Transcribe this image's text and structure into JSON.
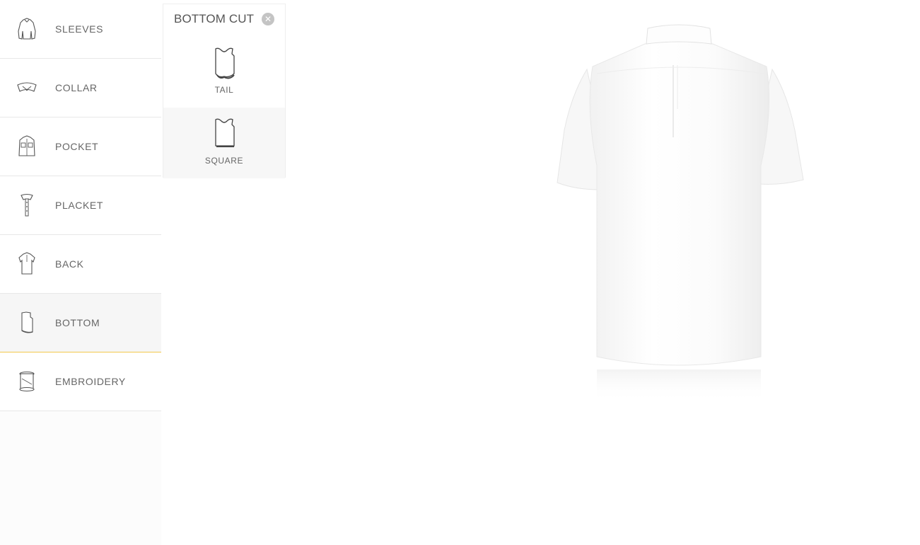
{
  "sidebar": {
    "items": [
      {
        "label": "SLEEVES",
        "icon": "sleeves-icon"
      },
      {
        "label": "COLLAR",
        "icon": "collar-icon"
      },
      {
        "label": "POCKET",
        "icon": "pocket-icon"
      },
      {
        "label": "PLACKET",
        "icon": "placket-icon"
      },
      {
        "label": "BACK",
        "icon": "back-icon"
      },
      {
        "label": "BOTTOM",
        "icon": "bottom-icon",
        "active": true
      },
      {
        "label": "EMBROIDERY",
        "icon": "embroidery-icon"
      }
    ]
  },
  "panel": {
    "title": "BOTTOM CUT",
    "close_glyph": "✕",
    "options": [
      {
        "label": "TAIL",
        "icon": "tail-cut-icon"
      },
      {
        "label": "SQUARE",
        "icon": "square-cut-icon",
        "selected": true
      }
    ]
  },
  "colors": {
    "accent": "#f2c94c",
    "text": "#666666",
    "shirt": "#ffffff"
  }
}
